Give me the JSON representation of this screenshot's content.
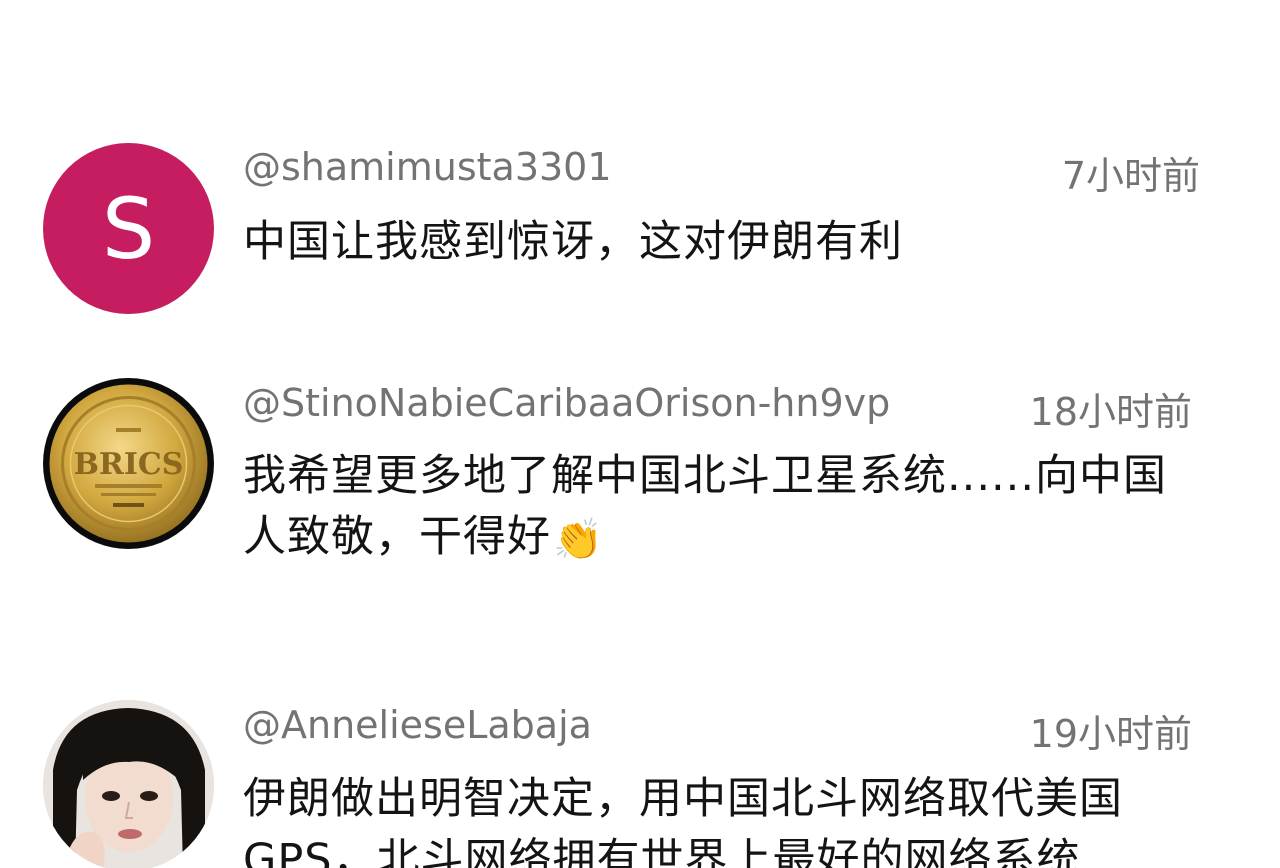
{
  "comments": [
    {
      "author": "@shamimusta3301",
      "time": "7小时前",
      "text": "中国让我感到惊讶，这对伊朗有利",
      "avatar": {
        "letter": "S",
        "color": "#C51D5F"
      }
    },
    {
      "author": "@StinoNabieCaribaaOrison-hn9vp",
      "time": "18小时前",
      "text": "我希望更多地了解中国北斗卫星系统......向中国人致敬，干得好",
      "emoji": "👏",
      "avatar": {
        "label": "BRICS",
        "color": "#C9A13A"
      }
    },
    {
      "author": "@AnnelieseLabaja",
      "time": "19小时前",
      "text": "伊朗做出明智决定，用中国北斗网络取代美国GPS，北斗网络拥有世界上最好的网络系统",
      "avatar": {
        "icon": "profile-photo"
      }
    }
  ]
}
